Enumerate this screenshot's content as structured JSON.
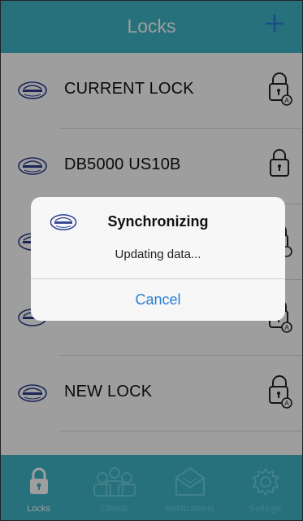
{
  "navbar": {
    "title": "Locks",
    "add_icon": "plus-icon",
    "add_label": "+"
  },
  "locks": [
    {
      "name": "CURRENT LOCK",
      "icon": "lock-auto-icon"
    },
    {
      "name": "DB5000 US10B",
      "icon": "lock-icon"
    },
    {
      "name": "",
      "icon": "lock-auto-icon"
    },
    {
      "name": "",
      "icon": "lock-auto-icon"
    },
    {
      "name": "NEW LOCK",
      "icon": "lock-auto-icon"
    }
  ],
  "tabs": [
    {
      "label": "Locks",
      "icon": "lock-icon",
      "active": true
    },
    {
      "label": "Clients",
      "icon": "clients-icon",
      "active": false
    },
    {
      "label": "Notifications",
      "icon": "envelope-icon",
      "active": false
    },
    {
      "label": "Settings",
      "icon": "gear-icon",
      "active": false
    }
  ],
  "dialog": {
    "title": "Synchronizing",
    "message": "Updating data...",
    "cancel_label": "Cancel",
    "logo_icon": "calroyal-logo-icon"
  },
  "colors": {
    "brand": "#3fb6c8",
    "link": "#2b7cd3",
    "tab_inactive": "#6ad0de"
  }
}
